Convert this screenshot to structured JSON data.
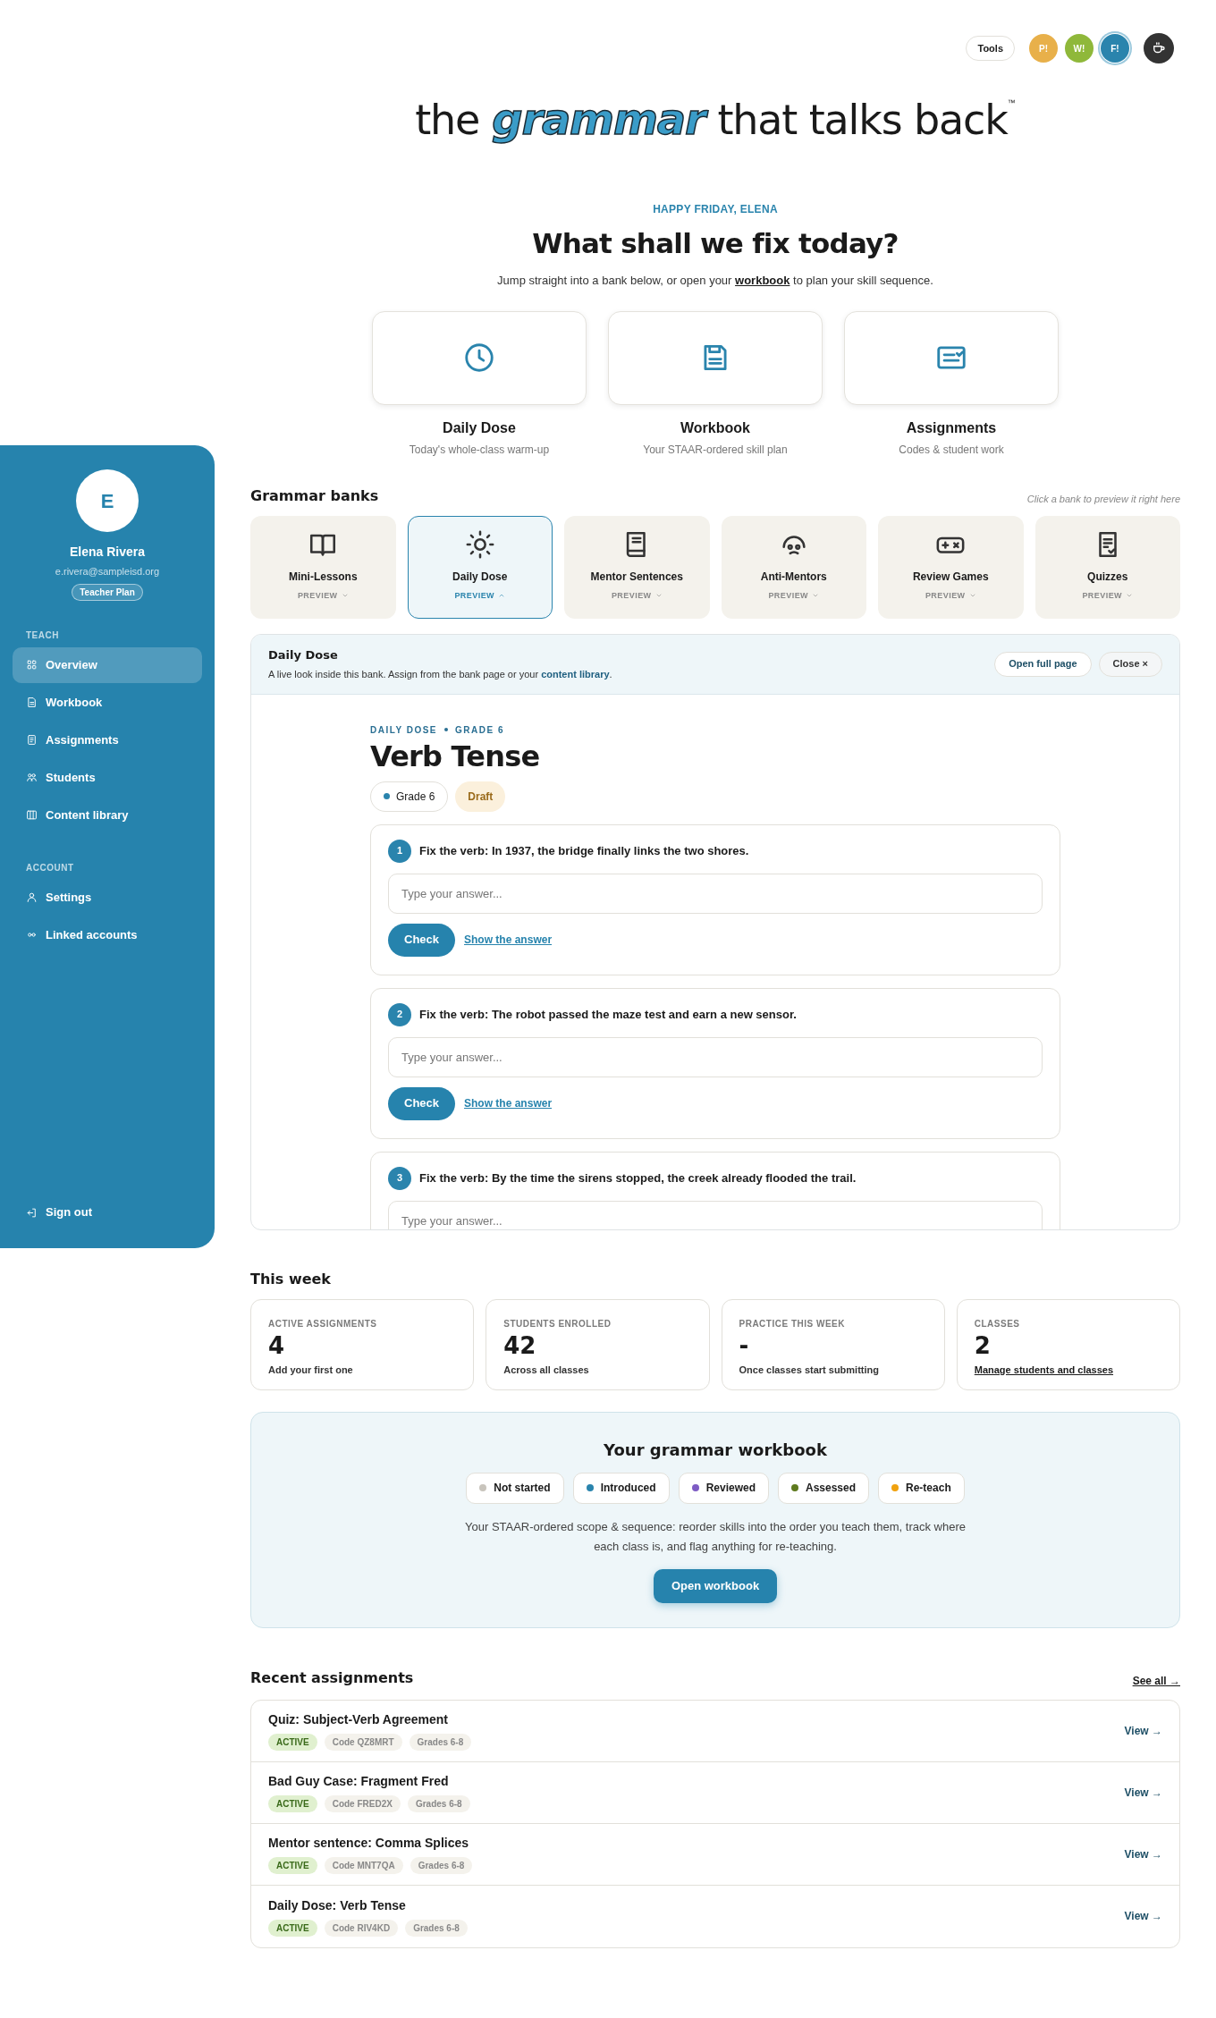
{
  "top_bar": {
    "tools_label": "Tools",
    "avatars": [
      {
        "label": "P!",
        "color": "#e8b04a",
        "selected": false
      },
      {
        "label": "W!",
        "color": "#8fb83a",
        "selected": false
      },
      {
        "label": "F!",
        "color": "#2a84ad",
        "selected": true
      }
    ]
  },
  "logo": {
    "before": "the",
    "highlight": "grammar",
    "after": "that talks back",
    "mark": "™"
  },
  "greeting": "HAPPY FRIDAY, ELENA",
  "heading": "What shall we fix today?",
  "intro": {
    "before": "Jump straight into a bank below, or open your",
    "link": "workbook",
    "after": "to plan your skill sequence."
  },
  "quick_links": [
    {
      "title": "Daily Dose",
      "subtitle": "Today's whole-class warm-up"
    },
    {
      "title": "Workbook",
      "subtitle": "Your STAAR-ordered skill plan"
    },
    {
      "title": "Assignments",
      "subtitle": "Codes & student work"
    }
  ],
  "sidebar": {
    "avatar_letter": "E",
    "name": "Elena Rivera",
    "email": "e.rivera@sampleisd.org",
    "plan": "Teacher Plan",
    "sections": [
      {
        "title": "TEACH",
        "items": [
          {
            "label": "Overview",
            "selected": true
          },
          {
            "label": "Workbook",
            "selected": false
          },
          {
            "label": "Assignments",
            "selected": false
          },
          {
            "label": "Students",
            "selected": false
          },
          {
            "label": "Content library",
            "selected": false
          }
        ]
      },
      {
        "title": "ACCOUNT",
        "items": [
          {
            "label": "Settings",
            "selected": false
          },
          {
            "label": "Linked accounts",
            "selected": false
          }
        ]
      }
    ],
    "sign_out": "Sign out"
  },
  "banks": {
    "title": "Grammar banks",
    "hint": "Click a bank to preview it right here",
    "items": [
      {
        "label": "Mini-Lessons",
        "preview": "PREVIEW",
        "selected": false
      },
      {
        "label": "Daily Dose",
        "preview": "PREVIEW",
        "selected": true
      },
      {
        "label": "Mentor Sentences",
        "preview": "PREVIEW",
        "selected": false
      },
      {
        "label": "Anti-Mentors",
        "preview": "PREVIEW",
        "selected": false
      },
      {
        "label": "Review Games",
        "preview": "PREVIEW",
        "selected": false
      },
      {
        "label": "Quizzes",
        "preview": "PREVIEW",
        "selected": false
      }
    ]
  },
  "preview": {
    "title": "Daily Dose",
    "description": {
      "before": "A live look inside this bank. Assign from the bank page or your",
      "link": "content library",
      "after": "."
    },
    "open_button": "Open full page",
    "close_button": "Close ×",
    "eyebrow": [
      "DAILY DOSE",
      "GRADE 6"
    ],
    "lesson_title": "Verb Tense",
    "chips": [
      {
        "label": "Grade 6",
        "kind": "dot"
      },
      {
        "label": "Draft",
        "kind": "status"
      }
    ],
    "questions": [
      {
        "number": "1",
        "prompt": "Fix the verb: In 1937, the bridge finally links the two shores.",
        "placeholder": "Type your answer...",
        "check": "Check",
        "show_answer": "Show the answer"
      },
      {
        "number": "2",
        "prompt": "Fix the verb: The robot passed the maze test and earn a new sensor.",
        "placeholder": "Type your answer...",
        "check": "Check",
        "show_answer": "Show the answer"
      },
      {
        "number": "3",
        "prompt": "Fix the verb: By the time the sirens stopped, the creek already flooded the trail.",
        "placeholder": "Type your answer..."
      }
    ]
  },
  "this_week": {
    "title": "This week",
    "stats": [
      {
        "label": "ACTIVE ASSIGNMENTS",
        "value": "4",
        "note": "Add your first one",
        "kind": "text"
      },
      {
        "label": "STUDENTS ENROLLED",
        "value": "42",
        "note": "Across all classes",
        "kind": "text"
      },
      {
        "label": "PRACTICE THIS WEEK",
        "value": "-",
        "note": "Once classes start submitting",
        "kind": "text"
      },
      {
        "label": "CLASSES",
        "value": "2",
        "note": "Manage students and classes",
        "kind": "link"
      }
    ]
  },
  "workbook": {
    "title": "Your grammar workbook",
    "legend": [
      {
        "label": "Not started",
        "color": "#c8c4bc"
      },
      {
        "label": "Introduced",
        "color": "#2a84ad"
      },
      {
        "label": "Reviewed",
        "color": "#7e5cc4"
      },
      {
        "label": "Assessed",
        "color": "#5e7a1e"
      },
      {
        "label": "Re-teach",
        "color": "#f0a20f"
      }
    ],
    "description": "Your STAAR-ordered scope & sequence: reorder skills into the order you teach them, track where each class is, and flag anything for re-teaching.",
    "button": "Open workbook"
  },
  "recent": {
    "title": "Recent assignments",
    "see_all": "See all →",
    "rows": [
      {
        "title": "Quiz: Subject-Verb Agreement",
        "status": "ACTIVE",
        "code": "Code QZ8MRT",
        "grades": "Grades 6-8",
        "view": "View →"
      },
      {
        "title": "Bad Guy Case: Fragment Fred",
        "status": "ACTIVE",
        "code": "Code FRED2X",
        "grades": "Grades 6-8",
        "view": "View →"
      },
      {
        "title": "Mentor sentence: Comma Splices",
        "status": "ACTIVE",
        "code": "Code MNT7QA",
        "grades": "Grades 6-8",
        "view": "View →"
      },
      {
        "title": "Daily Dose: Verb Tense",
        "status": "ACTIVE",
        "code": "Code RIV4KD",
        "grades": "Grades 6-8",
        "view": "View →"
      }
    ]
  }
}
